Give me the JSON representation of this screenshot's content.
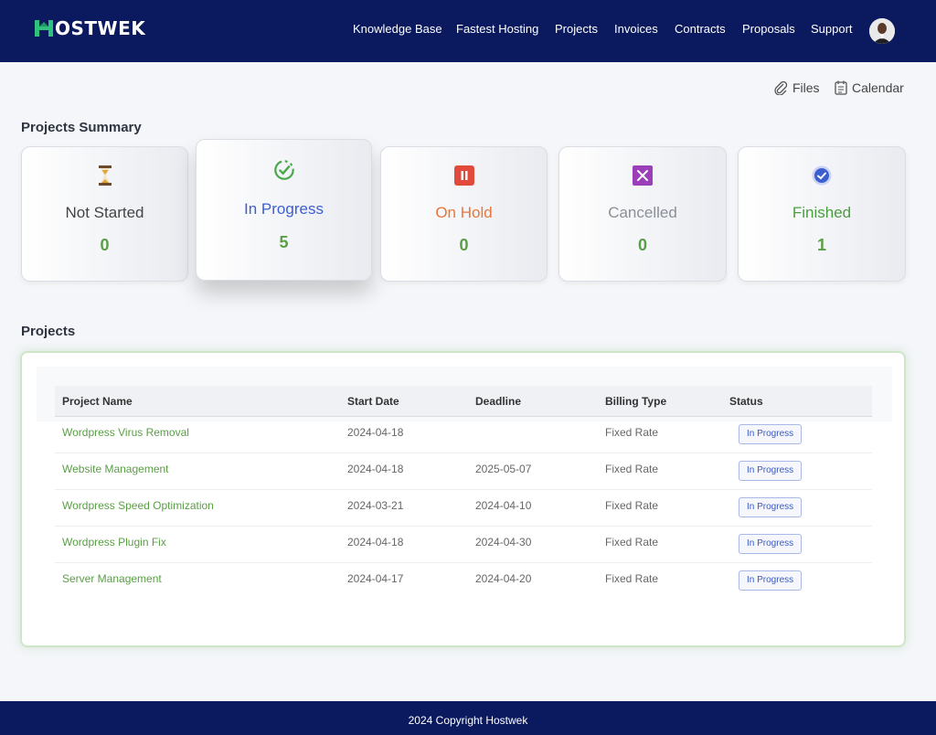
{
  "header": {
    "logo_text": "OSTWEK",
    "nav": [
      {
        "label": "Knowledge Base"
      },
      {
        "label": "Fastest Hosting"
      },
      {
        "label": "Projects"
      },
      {
        "label": "Invoices"
      },
      {
        "label": "Contracts"
      },
      {
        "label": "Proposals"
      },
      {
        "label": "Support"
      }
    ]
  },
  "actions": {
    "files_label": "Files",
    "calendar_label": "Calendar"
  },
  "summary": {
    "title": "Projects Summary",
    "cards": [
      {
        "label": "Not Started",
        "count": "0",
        "color": "#444444",
        "icon": "hourglass-icon"
      },
      {
        "label": "In Progress",
        "count": "5",
        "color": "#3b5fcf",
        "icon": "progress-check-icon"
      },
      {
        "label": "On Hold",
        "count": "0",
        "color": "#e8763a",
        "icon": "pause-icon"
      },
      {
        "label": "Cancelled",
        "count": "0",
        "color": "#8a8f99",
        "icon": "cancel-icon"
      },
      {
        "label": "Finished",
        "count": "1",
        "color": "#4a9e3f",
        "icon": "checkmark-circle-icon"
      }
    ]
  },
  "projects": {
    "title": "Projects",
    "columns": [
      "Project Name",
      "Start Date",
      "Deadline",
      "Billing Type",
      "Status"
    ],
    "rows": [
      {
        "name": "Wordpress Virus Removal",
        "start": "2024-04-18",
        "deadline": "",
        "billing": "Fixed Rate",
        "status": "In Progress"
      },
      {
        "name": "Website Management",
        "start": "2024-04-18",
        "deadline": "2025-05-07",
        "billing": "Fixed Rate",
        "status": "In Progress"
      },
      {
        "name": "Wordpress Speed Optimization",
        "start": "2024-03-21",
        "deadline": "2024-04-10",
        "billing": "Fixed Rate",
        "status": "In Progress"
      },
      {
        "name": "Wordpress Plugin Fix",
        "start": "2024-04-18",
        "deadline": "2024-04-30",
        "billing": "Fixed Rate",
        "status": "In Progress"
      },
      {
        "name": "Server Management",
        "start": "2024-04-17",
        "deadline": "2024-04-20",
        "billing": "Fixed Rate",
        "status": "In Progress"
      }
    ]
  },
  "footer": {
    "text": "2024 Copyright Hostwek"
  },
  "colors": {
    "nav_bg": "#0b1a5e",
    "accent_green": "#5a9e46",
    "badge_blue": "#3a5bbf"
  }
}
